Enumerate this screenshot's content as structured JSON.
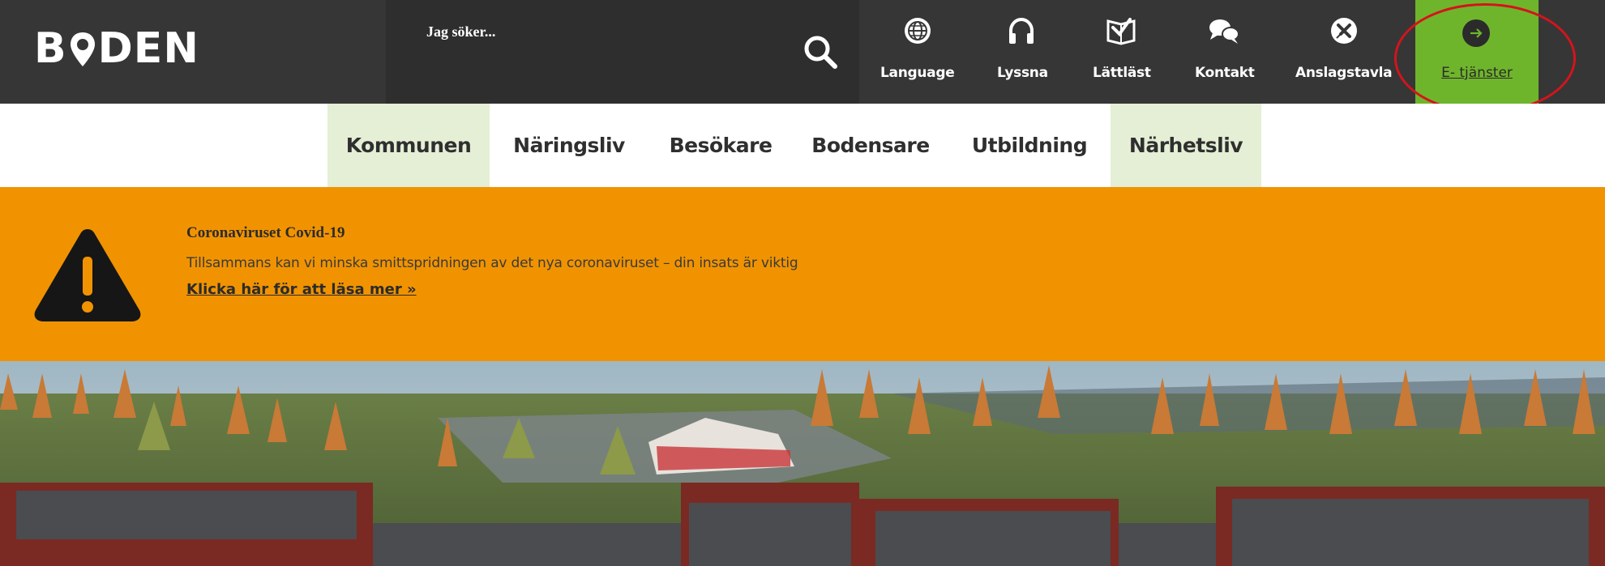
{
  "header": {
    "logo_text_1": "B",
    "logo_text_2": "DEN",
    "search": {
      "placeholder": "Jag söker..."
    },
    "utility_links": [
      {
        "label": "Language",
        "icon": "globe-icon"
      },
      {
        "label": "Lyssna",
        "icon": "headphones-icon"
      },
      {
        "label": "Lättläst",
        "icon": "open-book-icon"
      },
      {
        "label": "Kontakt",
        "icon": "chat-bubbles-icon"
      },
      {
        "label": "Anslagstavla",
        "icon": "pushpin-icon"
      }
    ],
    "eservices": {
      "label": "E- tjänster",
      "icon": "arrow-circle-icon"
    }
  },
  "nav": {
    "items": [
      {
        "label": "Kommunen",
        "active": true
      },
      {
        "label": "Näringsliv",
        "active": false
      },
      {
        "label": "Besökare",
        "active": false
      },
      {
        "label": "Bodensare",
        "active": false
      },
      {
        "label": "Utbildning",
        "active": false
      },
      {
        "label": "Närhetsliv",
        "active": true
      }
    ]
  },
  "banner": {
    "title": "Coronaviruset Covid-19",
    "text": "Tillsammans kan vi minska smittspridningen av det nya coronaviruset – din insats är viktig",
    "link": "Klicka här för att läsa mer »",
    "icon": "warning-icon"
  },
  "colors": {
    "header_bg": "#363636",
    "eservices_green": "#6fb52c",
    "nav_active_bg": "#e4efd5",
    "banner_orange": "#f19300",
    "annotation_red": "#d4141c"
  }
}
